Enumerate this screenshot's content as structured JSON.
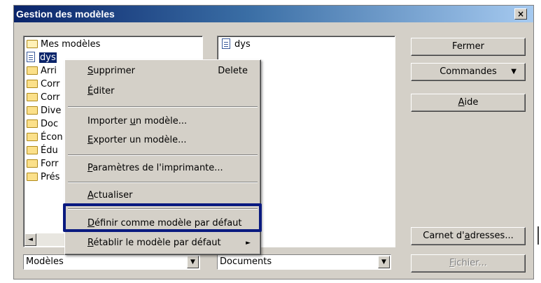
{
  "window": {
    "title": "Gestion des modèles",
    "close_label": "×"
  },
  "tree": {
    "root_label": "Mes modèles",
    "selected_item": "dys",
    "folders": [
      "Arri",
      "Corr",
      "Corr",
      "Dive",
      "Doc",
      "Écon",
      "Édu",
      "Forr",
      "Prés"
    ]
  },
  "documents": {
    "items": [
      "dys"
    ]
  },
  "buttons": {
    "fermer": {
      "pre": "Fermer",
      "u": "",
      "post": ""
    },
    "commandes": {
      "pre": "Commandes",
      "u": "",
      "post": "",
      "arrow": "▼"
    },
    "aide": {
      "pre": "",
      "u": "A",
      "post": "ide"
    },
    "carnet": {
      "pre": "Carnet d'",
      "u": "a",
      "post": "dresses..."
    },
    "fichier": {
      "pre": "",
      "u": "F",
      "post": "ichier..."
    }
  },
  "combos": {
    "left_value": "Modèles",
    "right_value": "Documents",
    "arrow": "▼"
  },
  "scroll": {
    "left_arrow": "◄"
  },
  "context_menu": {
    "supprimer": {
      "pre": "",
      "u": "S",
      "post": "upprimer",
      "shortcut": "Delete"
    },
    "editer": {
      "pre": "",
      "u": "É",
      "post": "diter"
    },
    "importer": {
      "pre": "Importer ",
      "u": "u",
      "post": "n modèle..."
    },
    "exporter": {
      "pre": "",
      "u": "E",
      "post": "xporter un modèle..."
    },
    "parametres": {
      "pre": "",
      "u": "P",
      "post": "aramètres de l'imprimante..."
    },
    "actualiser": {
      "pre": "",
      "u": "A",
      "post": "ctualiser"
    },
    "definir": {
      "pre": "",
      "u": "D",
      "post": "éfinir comme modèle par défaut"
    },
    "retablir": {
      "pre": "",
      "u": "R",
      "post": "établir le modèle par défaut",
      "submenu_arrow": "►"
    }
  },
  "colors": {
    "title_start": "#0a246a",
    "title_end": "#a6caf0",
    "highlight_border": "#0a1a80",
    "dialog_face": "#d4d0c8"
  }
}
